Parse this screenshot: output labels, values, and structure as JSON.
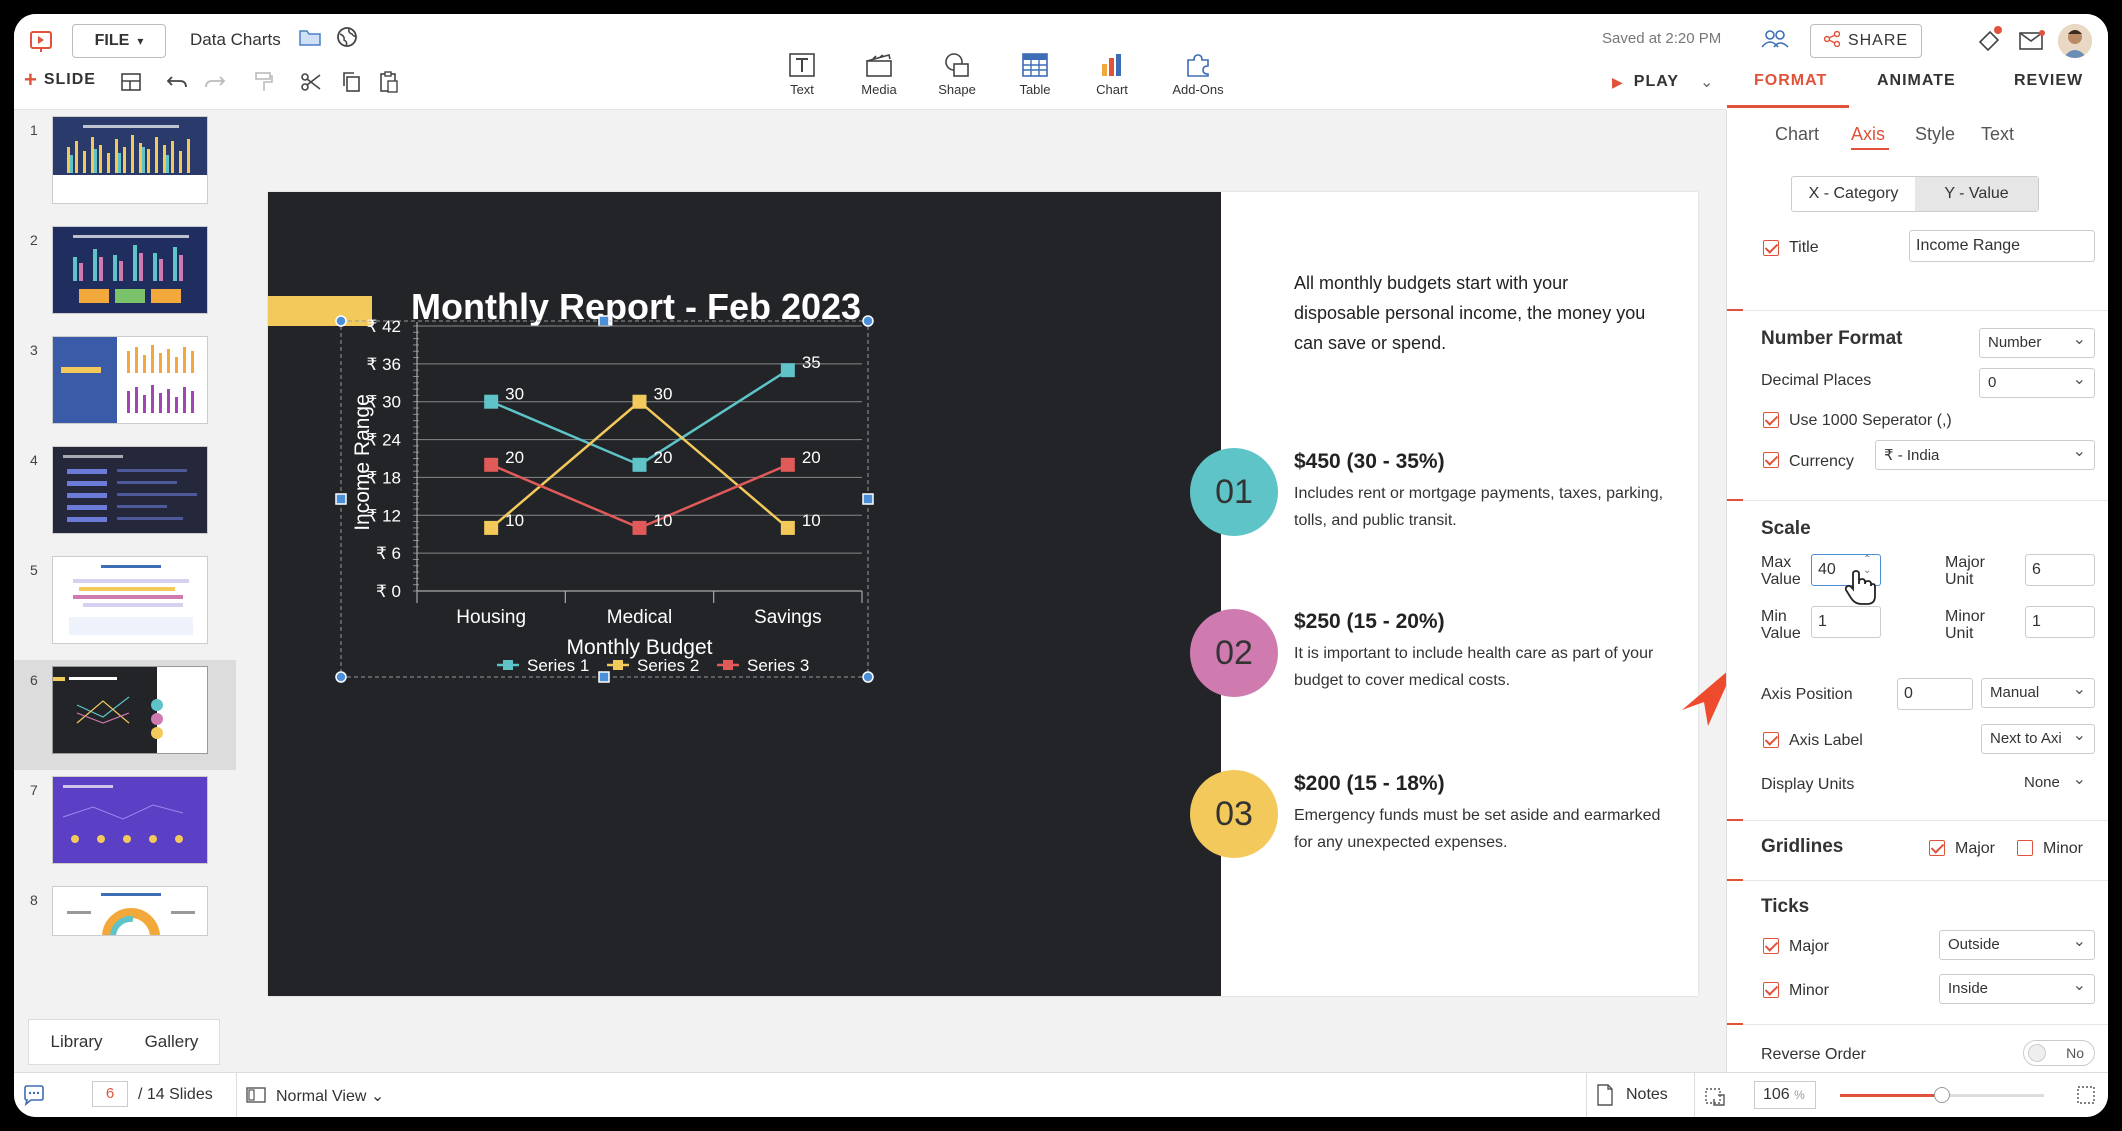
{
  "app": {
    "file_label": "FILE",
    "doc_title": "Data Charts",
    "saved_text": "Saved at 2:20 PM",
    "share_label": "SHARE",
    "slide_label": "SLIDE",
    "play_label": "PLAY"
  },
  "insert_tools": [
    {
      "label": "Text",
      "icon": "text-icon"
    },
    {
      "label": "Media",
      "icon": "media-icon"
    },
    {
      "label": "Shape",
      "icon": "shape-icon"
    },
    {
      "label": "Table",
      "icon": "table-icon"
    },
    {
      "label": "Chart",
      "icon": "chart-icon"
    },
    {
      "label": "Add-Ons",
      "icon": "addons-icon"
    }
  ],
  "panel_tabs": [
    "FORMAT",
    "ANIMATE",
    "REVIEW"
  ],
  "sub_tabs": [
    "Chart",
    "Axis",
    "Style",
    "Text"
  ],
  "axis_segments": [
    "X - Category",
    "Y - Value"
  ],
  "format": {
    "title_label": "Title",
    "title_value": "Income Range",
    "number_format_header": "Number Format",
    "number_format_value": "Number",
    "decimal_label": "Decimal Places",
    "decimal_value": "0",
    "separator_label": "Use 1000 Seperator (,)",
    "currency_label": "Currency",
    "currency_value": "₹ - India",
    "scale_header": "Scale",
    "max_label_1": "Max",
    "max_label_2": "Value",
    "max_value": "40",
    "major_label_1": "Major",
    "major_label_2": "Unit",
    "major_value": "6",
    "min_label_1": "Min",
    "min_label_2": "Value",
    "min_value": "1",
    "minor_label_1": "Minor",
    "minor_label_2": "Unit",
    "minor_value": "1",
    "axis_position_label": "Axis Position",
    "axis_position_value": "0",
    "axis_position_mode": "Manual",
    "axis_label_label": "Axis Label",
    "axis_label_value": "Next to Axi",
    "display_units_label": "Display Units",
    "display_units_value": "None",
    "gridlines_header": "Gridlines",
    "grid_major": "Major",
    "grid_minor": "Minor",
    "ticks_header": "Ticks",
    "ticks_major_label": "Major",
    "ticks_major_value": "Outside",
    "ticks_minor_label": "Minor",
    "ticks_minor_value": "Inside",
    "reverse_label": "Reverse Order",
    "reverse_value": "No"
  },
  "slide": {
    "title": "Monthly Report - Feb 2023",
    "intro": "All monthly budgets start with your disposable personal income, the money you can save or spend.",
    "sections": [
      {
        "num": "01",
        "color": "#5ec4c8",
        "heading": "$450 (30 - 35%)",
        "text": "Includes rent or mortgage payments, taxes, parking, tolls, and public transit."
      },
      {
        "num": "02",
        "color": "#d07bb0",
        "heading": "$250 (15 - 20%)",
        "text": "It is important to include health care as part of your budget to cover medical costs."
      },
      {
        "num": "03",
        "color": "#f3c95c",
        "heading": "$200 (15 - 18%)",
        "text": "Emergency funds must be set aside and earmarked for any unexpected expenses."
      }
    ]
  },
  "chart_data": {
    "type": "line",
    "categories": [
      "Housing",
      "Medical",
      "Savings"
    ],
    "series": [
      {
        "name": "Series 1",
        "color": "#5ec4c8",
        "values": [
          30,
          20,
          35
        ]
      },
      {
        "name": "Series 2",
        "color": "#f3c95c",
        "values": [
          10,
          30,
          10
        ]
      },
      {
        "name": "Series 3",
        "color": "#e05a5a",
        "values": [
          20,
          10,
          20
        ]
      }
    ],
    "yticks": [
      "₹ 0",
      "₹ 6",
      "₹ 12",
      "₹ 18",
      "₹ 24",
      "₹ 30",
      "₹ 36",
      "₹ 42"
    ],
    "ylim": [
      0,
      42
    ],
    "xlabel": "Monthly Budget",
    "ylabel": "Income Range",
    "legend": "bottom",
    "grid": true
  },
  "thumbnails": [
    "1",
    "2",
    "3",
    "4",
    "5",
    "6",
    "7",
    "8"
  ],
  "bottom": {
    "library": "Library",
    "gallery": "Gallery",
    "slide_num": "6",
    "total": "/ 14 Slides",
    "view": "Normal View",
    "notes": "Notes",
    "zoom": "106",
    "zoom_unit": "%"
  }
}
